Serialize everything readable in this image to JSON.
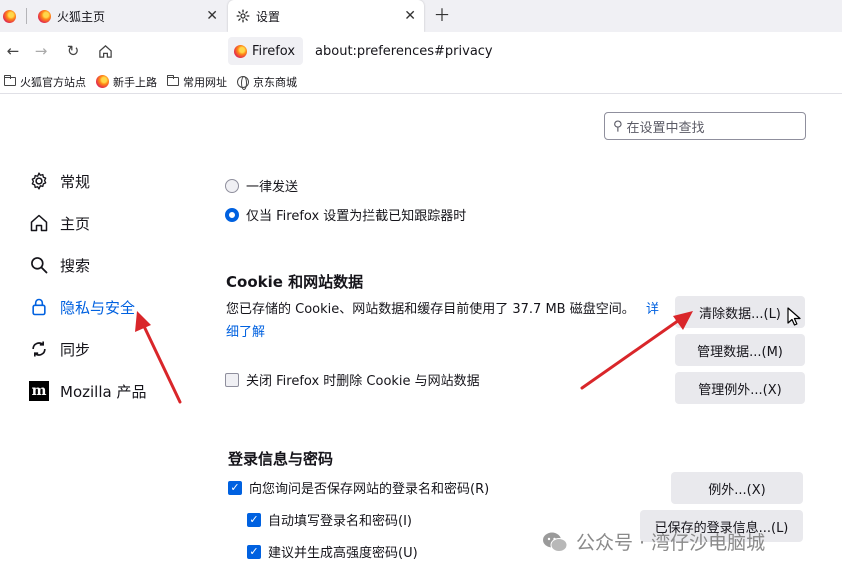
{
  "tabs": [
    {
      "label": ""
    },
    {
      "label": "火狐主页"
    },
    {
      "label": "设置"
    }
  ],
  "url": {
    "identity": "Firefox",
    "address": "about:preferences#privacy"
  },
  "bookmarks": [
    {
      "label": "火狐官方站点",
      "icon": "folder-icon"
    },
    {
      "label": "新手上路",
      "icon": "firefox-icon"
    },
    {
      "label": "常用网址",
      "icon": "folder-icon"
    },
    {
      "label": "京东商城",
      "icon": "globe-icon"
    }
  ],
  "search": {
    "placeholder": "在设置中查找"
  },
  "sidebar": {
    "items": [
      {
        "label": "常规",
        "icon": "gear-icon"
      },
      {
        "label": "主页",
        "icon": "home-icon"
      },
      {
        "label": "搜索",
        "icon": "search-icon"
      },
      {
        "label": "隐私与安全",
        "icon": "lock-icon"
      },
      {
        "label": "同步",
        "icon": "sync-icon"
      },
      {
        "label": "Mozilla 产品",
        "icon": "mozilla-icon"
      }
    ]
  },
  "dnt": {
    "always": "一律发送",
    "only_when": "仅当 Firefox 设置为拦截已知跟踪器时"
  },
  "cookies": {
    "title": "Cookie 和网站数据",
    "description": "您已存储的 Cookie、网站数据和缓存目前使用了 37.7 MB 磁盘空间。",
    "link_part1": "详",
    "link_part2": "细了解",
    "clear_button": "清除数据...(L)",
    "manage_button": "管理数据...(M)",
    "exceptions_button": "管理例外...(X)",
    "delete_on_close": "关闭 Firefox 时删除 Cookie 与网站数据"
  },
  "logins": {
    "title": "登录信息与密码",
    "ask_save": "向您询问是否保存网站的登录名和密码(R)",
    "autofill": "自动填写登录名和密码(I)",
    "suggest": "建议并生成高强度密码(U)",
    "exceptions_button": "例外...(X)",
    "saved_button": "已保存的登录信息...(L)"
  },
  "watermark": {
    "text": "公众号 · 湾仔沙电脑城"
  },
  "colors": {
    "accent": "#0061e0",
    "arrow": "#d9262a",
    "button_bg": "#e9e9ed"
  }
}
